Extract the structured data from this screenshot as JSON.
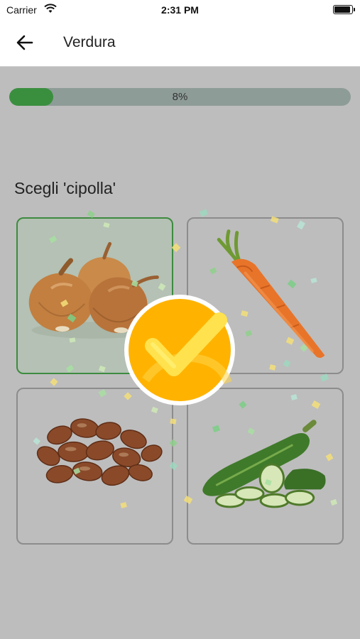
{
  "status_bar": {
    "carrier": "Carrier",
    "time": "2:31 PM",
    "battery_level": 0.95
  },
  "app_bar": {
    "title": "Verdura"
  },
  "progress": {
    "value": 0.08,
    "label": "8%"
  },
  "question": {
    "text": "Scegli 'cipolla'"
  },
  "options": [
    {
      "item": "cipolla",
      "image": "onions",
      "selected": true
    },
    {
      "item": "carota",
      "image": "carrot",
      "selected": false
    },
    {
      "item": "fave",
      "image": "fava-beans",
      "selected": false
    },
    {
      "item": "zucchina",
      "image": "zucchini",
      "selected": false
    }
  ],
  "feedback": {
    "icon": "checkmark-icon",
    "state": "correct"
  },
  "colors": {
    "progress_fill": "#3a8f3f",
    "progress_track": "#8e9c98",
    "selected_border": "#3d8b3f",
    "badge": "#ffb300",
    "check": "#ffe24d"
  }
}
